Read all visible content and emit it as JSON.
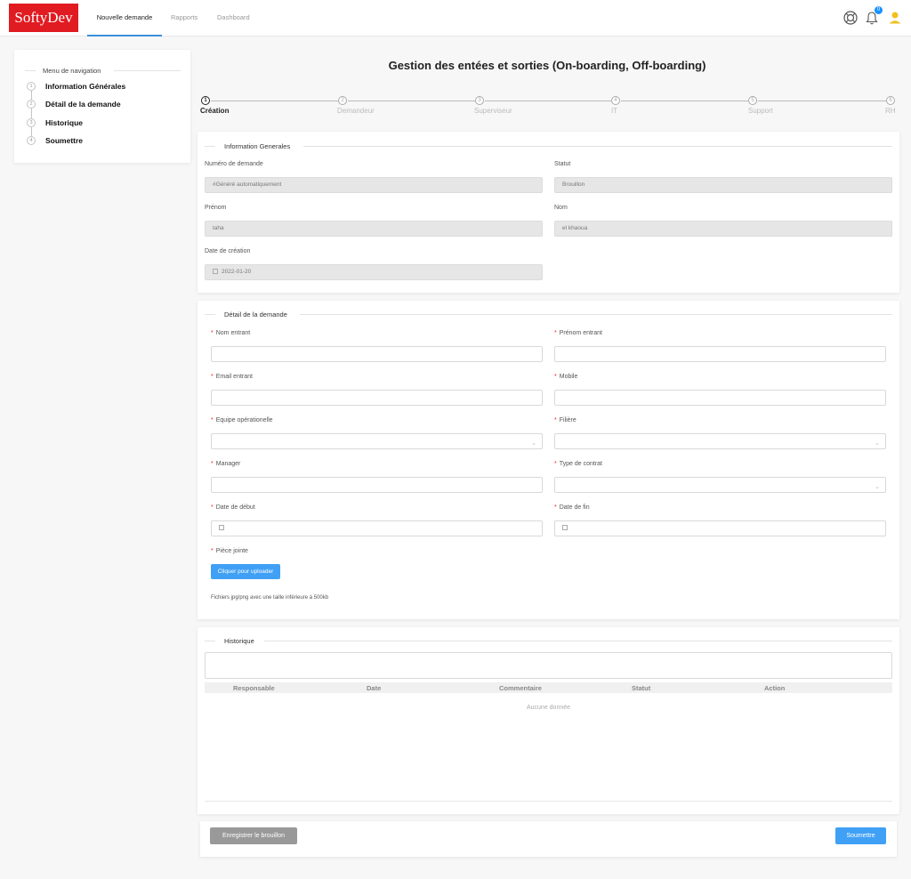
{
  "header": {
    "logo": "SoftyDev",
    "nav": [
      "Nouvelle demande",
      "Rapports",
      "Dashboard"
    ],
    "active_nav": "Nouvelle demande",
    "icons": [
      "lifebuoy-icon",
      "bell-icon",
      "user-icon"
    ],
    "notification_count": "0"
  },
  "sidebar": {
    "title": "Menu de navigation",
    "items": [
      {
        "num": "1",
        "label": "Information Générales"
      },
      {
        "num": "2",
        "label": "Détail de la demande"
      },
      {
        "num": "3",
        "label": "Historique"
      },
      {
        "num": "4",
        "label": "Soumettre"
      }
    ]
  },
  "page": {
    "title": "Gestion des entées et sorties (On-boarding, Off-boarding)"
  },
  "stepper": {
    "steps": [
      {
        "num": "1",
        "label": "Création"
      },
      {
        "num": "2",
        "label": "Demandeur"
      },
      {
        "num": "3",
        "label": "Superviseur"
      },
      {
        "num": "4",
        "label": "IT"
      },
      {
        "num": "5",
        "label": "Support"
      },
      {
        "num": "6",
        "label": "RH"
      }
    ],
    "active_step": 1
  },
  "info": {
    "legend": "Information Generales",
    "numero_label": "Numéro de demande",
    "numero_value": "#Généré automatiquement",
    "statut_label": "Statut",
    "statut_value": "Brouillon",
    "prenom_label": "Prénom",
    "prenom_value": "taha",
    "nom_label": "Nom",
    "nom_value": "el khaoua",
    "date_label": "Date de création",
    "date_value": "2022-01-20"
  },
  "detail": {
    "legend": "Détail de la demande",
    "nom_entrant": "Nom entrant",
    "prenom_entrant": "Prénom entrant",
    "email_entrant": "Email entrant",
    "mobile": "Mobile",
    "equipe": "Equipe opérationelle",
    "filiere": "Filière",
    "manager": "Manager",
    "type_contrat": "Type de contrat",
    "date_debut": "Date de début",
    "date_fin": "Date de fin",
    "piece_jointe": "Pièce jointe",
    "upload_button": "Cliquer pour uploader",
    "upload_hint": "Fichiers jpg/png avec une taille inférieure à 500kb"
  },
  "historique": {
    "legend": "Historique",
    "columns": [
      "Responsable",
      "Date",
      "Commentaire",
      "Statut",
      "Action"
    ],
    "empty": "Aucune donnée"
  },
  "footer": {
    "draft_button": "Enregistrer le brouillon",
    "submit_button": "Soumettre"
  },
  "colors": {
    "brand": "#e11b22",
    "primary": "#40a0f5",
    "required": "#f5222d"
  }
}
